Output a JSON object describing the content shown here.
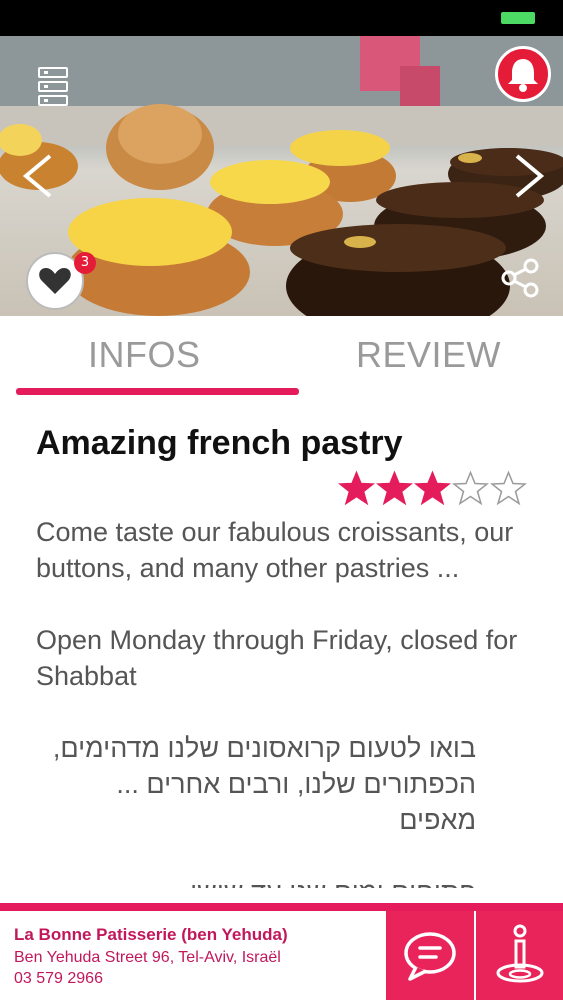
{
  "status_bar": {
    "battery_color": "#4cd964"
  },
  "hero": {
    "icons": [
      "menu-icon",
      "bell-icon",
      "chevron-left-icon",
      "chevron-right-icon",
      "heart-icon",
      "share-icon"
    ],
    "like_count": "3"
  },
  "tabs": [
    {
      "label": "INFOS",
      "active": true
    },
    {
      "label": "REVIEW",
      "active": false
    }
  ],
  "listing": {
    "title": "Amazing french pastry",
    "rating": 3,
    "rating_max": 5,
    "description": [
      "Come taste our fabulous croissants, our buttons, and many other pastries ...",
      "Open Monday through Friday, closed for Shabbat",
      "בואו לטעום קרואסונים שלנו מדהימים, הכפתורים שלנו, ורבים אחרים ... מאפים",
      "פתוחים ימים שני עד שישי"
    ]
  },
  "footer": {
    "name": "La Bonne Patisserie (ben Yehuda)",
    "address": "Ben Yehuda Street 96, Tel-Aviv, Israël",
    "phone": "03 579 2966",
    "icons": [
      "chat-icon",
      "info-location-icon"
    ]
  },
  "colors": {
    "accent": "#e51c5c",
    "accent_dark": "#c2185b",
    "alert": "#e51c37"
  }
}
